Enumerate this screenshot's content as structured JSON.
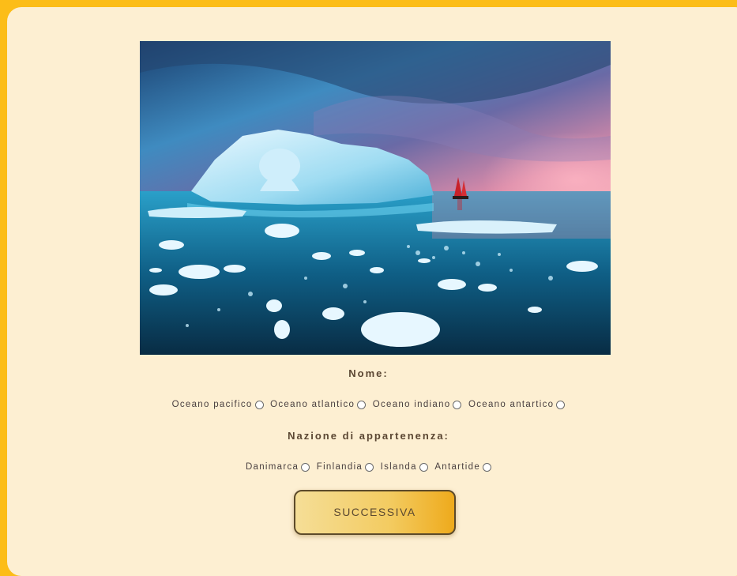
{
  "question": {
    "name_label": "Nome:",
    "ocean_options": [
      {
        "label": "Oceano pacifico"
      },
      {
        "label": "Oceano atlantico"
      },
      {
        "label": "Oceano indiano"
      },
      {
        "label": "Oceano antartico"
      }
    ],
    "nation_label": "Nazione di appartenenza:",
    "nation_options": [
      {
        "label": "Danimarca"
      },
      {
        "label": "Finlandia"
      },
      {
        "label": "Islanda"
      },
      {
        "label": "Antartide"
      }
    ]
  },
  "next_button": {
    "label": "SUCCESSIVA"
  },
  "colors": {
    "page_border": "#fcbd18",
    "card_background": "#fdefd2",
    "button_gradient_start": "#f5de97",
    "button_gradient_end": "#eeaa1c"
  }
}
